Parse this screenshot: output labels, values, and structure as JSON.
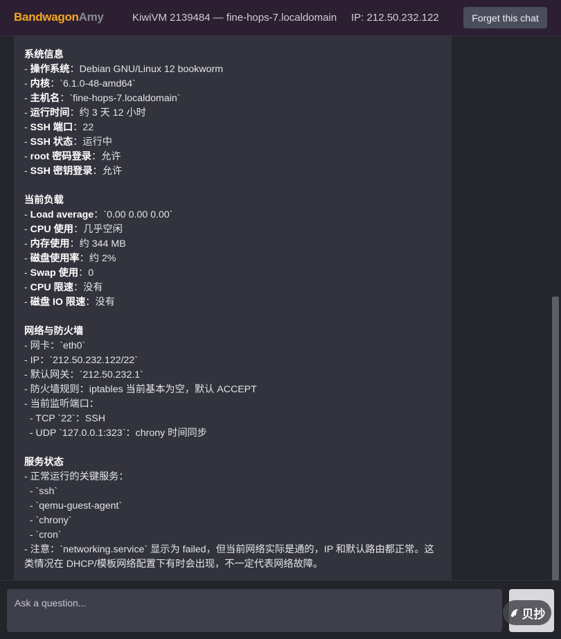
{
  "header": {
    "logo_part1": "Bandwagon",
    "logo_part2": "Amy",
    "vm_info": "KiwiVM 2139484 — fine-hops-7.localdomain",
    "ip_info": "IP: 212.50.232.122",
    "forget_label": "Forget this chat"
  },
  "message": {
    "system": {
      "heading": "系统信息",
      "items": [
        {
          "prefix": "- ",
          "label": "操作系统",
          "sep": "：",
          "value": "Debian GNU/Linux 12 bookworm"
        },
        {
          "prefix": "- ",
          "label": "内核",
          "sep": "：",
          "value": "`6.1.0-48-amd64`"
        },
        {
          "prefix": "- ",
          "label": "主机名",
          "sep": "：",
          "value": "`fine-hops-7.localdomain`"
        },
        {
          "prefix": "- ",
          "label": "运行时间",
          "sep": "：",
          "value": "约 3 天 12 小时"
        },
        {
          "prefix": "- ",
          "label": "SSH 端口",
          "sep": "：",
          "value": "22"
        },
        {
          "prefix": "- ",
          "label": "SSH 状态",
          "sep": "：",
          "value": "运行中"
        },
        {
          "prefix": "- ",
          "label": "root 密码登录",
          "sep": "：",
          "value": "允许"
        },
        {
          "prefix": "- ",
          "label": "SSH 密钥登录",
          "sep": "：",
          "value": "允许"
        }
      ]
    },
    "load": {
      "heading": "当前负载",
      "items": [
        {
          "prefix": "- ",
          "label": "Load average",
          "sep": "：",
          "value": "`0.00 0.00 0.00`"
        },
        {
          "prefix": "- ",
          "label": "CPU 使用",
          "sep": "：",
          "value": "几乎空闲"
        },
        {
          "prefix": "- ",
          "label": "内存使用",
          "sep": "：",
          "value": "约 344 MB"
        },
        {
          "prefix": "- ",
          "label": "磁盘使用率",
          "sep": "：",
          "value": "约 2%"
        },
        {
          "prefix": "- ",
          "label": "Swap 使用",
          "sep": "：",
          "value": "0"
        },
        {
          "prefix": "- ",
          "label": "CPU 限速",
          "sep": "：",
          "value": "没有"
        },
        {
          "prefix": "- ",
          "label": "磁盘 IO 限速",
          "sep": "：",
          "value": "没有"
        }
      ]
    },
    "network": {
      "heading": "网络与防火墙",
      "lines": [
        "- 网卡：`eth0`",
        "- IP：`212.50.232.122/22`",
        "- 默认网关：`212.50.232.1`",
        "- 防火墙规则：iptables 当前基本为空，默认 ACCEPT",
        "- 当前监听端口：",
        "  - TCP `22`：SSH",
        "  - UDP `127.0.0.1:323`：chrony 时间同步"
      ]
    },
    "services": {
      "heading": "服务状态",
      "lines": [
        "- 正常运行的关键服务：",
        "  - `ssh`",
        "  - `qemu-guest-agent`",
        "  - `chrony`",
        "  - `cron`"
      ],
      "note": "- 注意：`networking.service` 显示为 failed，但当前网络实际是通的，IP 和默认路由都正常。这类情况在 DHCP/模板网络配置下有时会出现，不一定代表网络故障。"
    }
  },
  "composer": {
    "placeholder": "Ask a question...",
    "send_label": "Send"
  },
  "watermark": {
    "text": "贝抄"
  }
}
